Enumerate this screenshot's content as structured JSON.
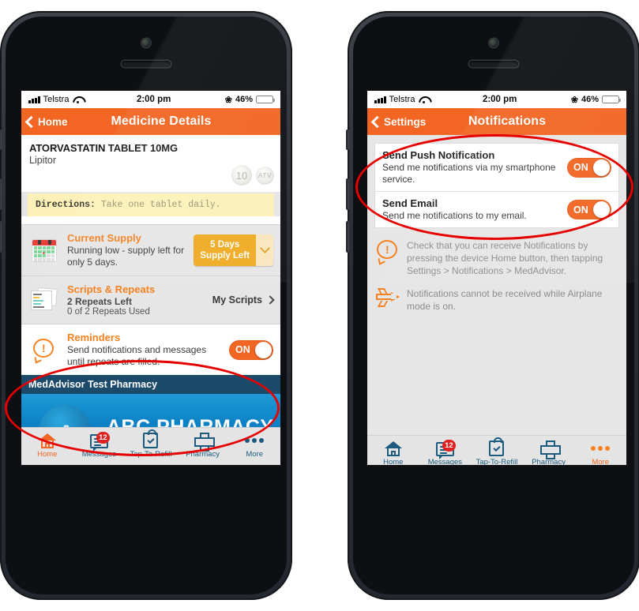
{
  "status_bar": {
    "carrier": "Telstra",
    "time": "2:00 pm",
    "battery_percent": "46%",
    "bluetooth_icon": "bluetooth-icon",
    "wifi_icon": "wifi-icon",
    "signal_icon": "signal-bars-icon"
  },
  "left_phone": {
    "nav": {
      "back_label": "Home",
      "title": "Medicine Details",
      "back_icon": "chevron-left-icon"
    },
    "medicine": {
      "name": "ATORVASTATIN TABLET 10MG",
      "brand": "Lipitor",
      "pill_1_label": "10",
      "pill_2_label": "ATV"
    },
    "directions": {
      "label": "Directions:",
      "text": "Take one tablet daily."
    },
    "current_supply": {
      "title": "Current Supply",
      "subtitle": "Running low - supply left for only 5 days.",
      "button_line1": "5 Days",
      "button_line2": "Supply Left",
      "dropdown_icon": "chevron-down-icon",
      "icon": "calendar-icon"
    },
    "scripts": {
      "title": "Scripts & Repeats",
      "repeats_left": "2 Repeats Left",
      "repeats_used": "0 of 2 Repeats Used",
      "action_label": "My Scripts",
      "action_icon": "chevron-right-icon",
      "icon": "scripts-document-icon"
    },
    "reminders": {
      "title": "Reminders",
      "subtitle": "Send notifications and messages until repeats are filled.",
      "toggle_state": "ON",
      "icon": "alert-bubble-icon"
    },
    "pharmacy": {
      "band_title": "MedAdvisor Test Pharmacy",
      "hero_logo_letter": "A",
      "hero_title": "ABC PHARMACY"
    },
    "tabs": [
      {
        "label": "Home",
        "icon": "home-icon",
        "active": true,
        "badge": ""
      },
      {
        "label": "Messages",
        "icon": "messages-icon",
        "active": false,
        "badge": "12"
      },
      {
        "label": "Tap-To-Refill",
        "icon": "refill-bag-icon",
        "active": false,
        "badge": ""
      },
      {
        "label": "Pharmacy",
        "icon": "cross-icon",
        "active": false,
        "badge": ""
      },
      {
        "label": "More",
        "icon": "more-dots-icon",
        "active": false,
        "badge": ""
      }
    ]
  },
  "right_phone": {
    "nav": {
      "back_label": "Settings",
      "title": "Notifications",
      "back_icon": "chevron-left-icon"
    },
    "settings_rows": [
      {
        "title": "Send Push Notification",
        "subtitle": "Send me notifications via my smartphone service.",
        "toggle_state": "ON"
      },
      {
        "title": "Send Email",
        "subtitle": "Send me notifications to my email.",
        "toggle_state": "ON"
      }
    ],
    "notes": [
      {
        "icon": "alert-bubble-icon",
        "text": "Check that you can receive Notifications by pressing the device Home button, then tapping Settings > Notifications > MedAdvisor."
      },
      {
        "icon": "airplane-icon",
        "text": "Notifications cannot be received while Airplane mode is on."
      }
    ],
    "tabs": [
      {
        "label": "Home",
        "icon": "home-icon",
        "active": false,
        "badge": ""
      },
      {
        "label": "Messages",
        "icon": "messages-icon",
        "active": false,
        "badge": "12"
      },
      {
        "label": "Tap-To-Refill",
        "icon": "refill-bag-icon",
        "active": false,
        "badge": ""
      },
      {
        "label": "Pharmacy",
        "icon": "cross-icon",
        "active": false,
        "badge": ""
      },
      {
        "label": "More",
        "icon": "more-dots-icon",
        "active": true,
        "badge": ""
      }
    ]
  },
  "annotations": {
    "oval_color": "#e60000",
    "left_oval_target": "reminders-row",
    "right_oval_target": "notification-settings-card"
  },
  "colors": {
    "accent_orange": "#f26522",
    "title_orange": "#f58220",
    "tab_blue": "#1c5b7e",
    "supply_gold": "#eeaa22",
    "badge_red": "#e02020",
    "screen_bg": "#e6e6e6"
  }
}
